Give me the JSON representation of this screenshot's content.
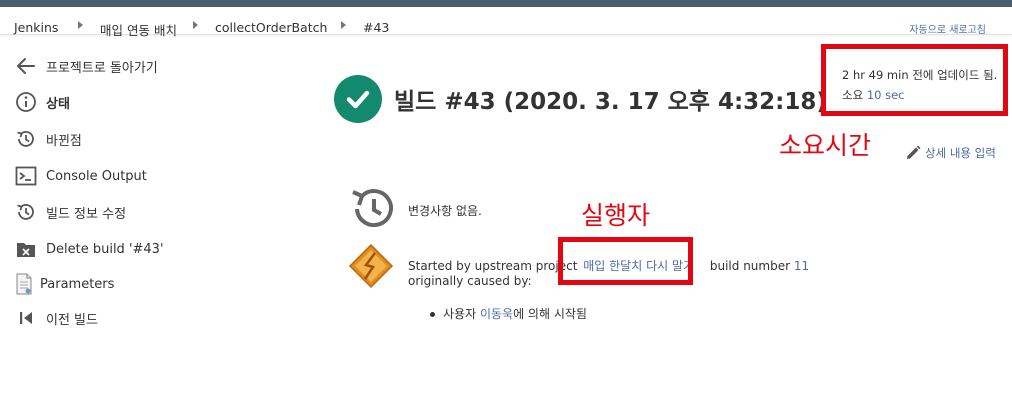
{
  "breadcrumb": [
    "Jenkins",
    "매입 연동 배치",
    "collectOrderBatch",
    "#43"
  ],
  "auto_refresh": "자동으로 새로고침",
  "sidebar": [
    {
      "label": "프로젝트로 돌아가기",
      "icon": "arrow-left-icon"
    },
    {
      "label": "상태",
      "icon": "info-icon"
    },
    {
      "label": "바뀐점",
      "icon": "history-icon"
    },
    {
      "label": "Console Output",
      "icon": "terminal-icon"
    },
    {
      "label": "빌드 정보 수정",
      "icon": "history-icon"
    },
    {
      "label": "Delete build '#43'",
      "icon": "folder-delete-icon"
    },
    {
      "label": "Parameters",
      "icon": "document-icon"
    },
    {
      "label": "이전 빌드",
      "icon": "previous-icon"
    }
  ],
  "build": {
    "title": "빌드 #43 (2020. 3. 17 오후 4:32:18)",
    "updated": "2 hr 49 min 전에 업데이드 됨.",
    "duration_prefix": "소요",
    "duration": "10 sec",
    "edit_description": "상세 내용 입력",
    "no_changes": "변경사항 없음.",
    "started_by_prefix": "Started by upstream project",
    "upstream_project": "매입 한달치 다시 말기",
    "build_number_prefix": "build number",
    "build_number": "11",
    "originally_caused": "originally caused by:",
    "user_prefix": "사용자",
    "user": "이동욱",
    "user_suffix": "에 의해 시작됨"
  },
  "annotations": {
    "duration_label": "소요시간",
    "executor_label": "실행자"
  },
  "colors": {
    "success": "#138a6e",
    "annotation_red": "#e30613",
    "link": "#4b6ba5"
  }
}
